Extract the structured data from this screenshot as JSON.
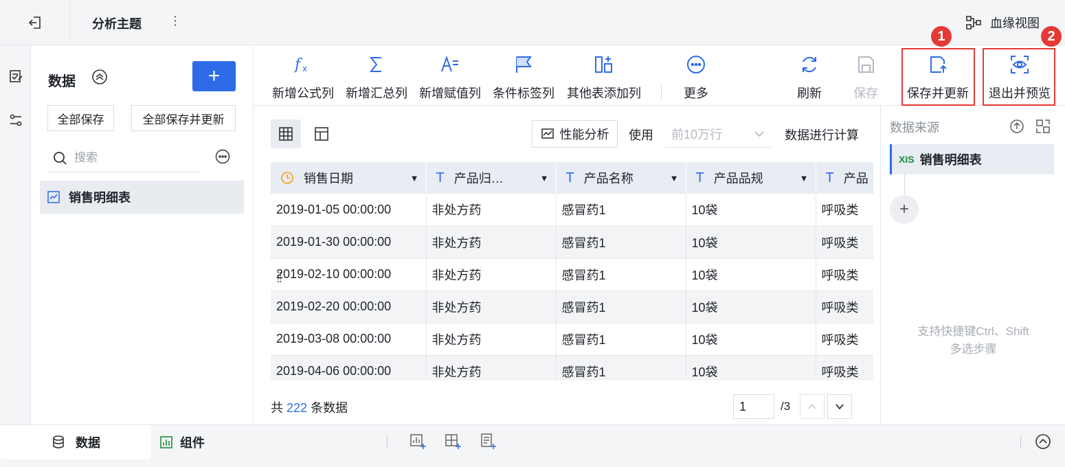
{
  "header": {
    "title": "分析主题",
    "lineage_label": "血缘视图"
  },
  "data_panel": {
    "title": "数据",
    "add_label": "+",
    "save_all": "全部保存",
    "save_all_update": "全部保存并更新",
    "search_placeholder": "搜索",
    "table_name": "销售明细表"
  },
  "toolbar": {
    "items": [
      {
        "label": "新增公式列",
        "icon": "formula-icon"
      },
      {
        "label": "新增汇总列",
        "icon": "sigma-icon"
      },
      {
        "label": "新增赋值列",
        "icon": "assign-icon"
      },
      {
        "label": "条件标签列",
        "icon": "flag-icon"
      },
      {
        "label": "其他表添加列",
        "icon": "add-column-icon"
      },
      {
        "label": "更多",
        "icon": "more-icon"
      },
      {
        "label": "刷新",
        "icon": "refresh-icon"
      },
      {
        "label": "保存",
        "icon": "save-icon"
      },
      {
        "label": "保存并更新",
        "icon": "save-update-icon"
      },
      {
        "label": "退出并预览",
        "icon": "preview-icon"
      }
    ],
    "badges": [
      "1",
      "2"
    ],
    "highlight_color": "#e53935"
  },
  "grid": {
    "perf_label": "性能分析",
    "use_label": "使用",
    "rows_option": "前10万行",
    "calc_label": "数据进行计算",
    "columns": [
      "销售日期",
      "产品归…",
      "产品名称",
      "产品品规",
      "产品"
    ],
    "rows": [
      [
        "2019-01-05 00:00:00",
        "非处方药",
        "感冒药1",
        "10袋",
        "呼吸类"
      ],
      [
        "2019-01-30 00:00:00",
        "非处方药",
        "感冒药1",
        "10袋",
        "呼吸类"
      ],
      [
        "2019-02-10 00:00:00",
        "非处方药",
        "感冒药1",
        "10袋",
        "呼吸类"
      ],
      [
        "2019-02-20 00:00:00",
        "非处方药",
        "感冒药1",
        "10袋",
        "呼吸类"
      ],
      [
        "2019-03-08 00:00:00",
        "非处方药",
        "感冒药1",
        "10袋",
        "呼吸类"
      ],
      [
        "2019-04-06 00:00:00",
        "非处方药",
        "感冒药1",
        "10袋",
        "呼吸类"
      ]
    ],
    "total_prefix": "共",
    "total_count": "222",
    "total_suffix": "条数据",
    "page": "1",
    "page_total": "/3"
  },
  "source_panel": {
    "title": "数据来源",
    "item": "销售明细表",
    "item_icon_text": "XIS",
    "add_label": "+",
    "hint_line1": "支持快捷键Ctrl、Shift",
    "hint_line2": "多选步骤"
  },
  "bottom": {
    "tab_data": "数据",
    "tab_component": "组件"
  },
  "colors": {
    "accent": "#2e6be6",
    "highlight": "#e53935",
    "excel_green": "#1f8a3b"
  }
}
